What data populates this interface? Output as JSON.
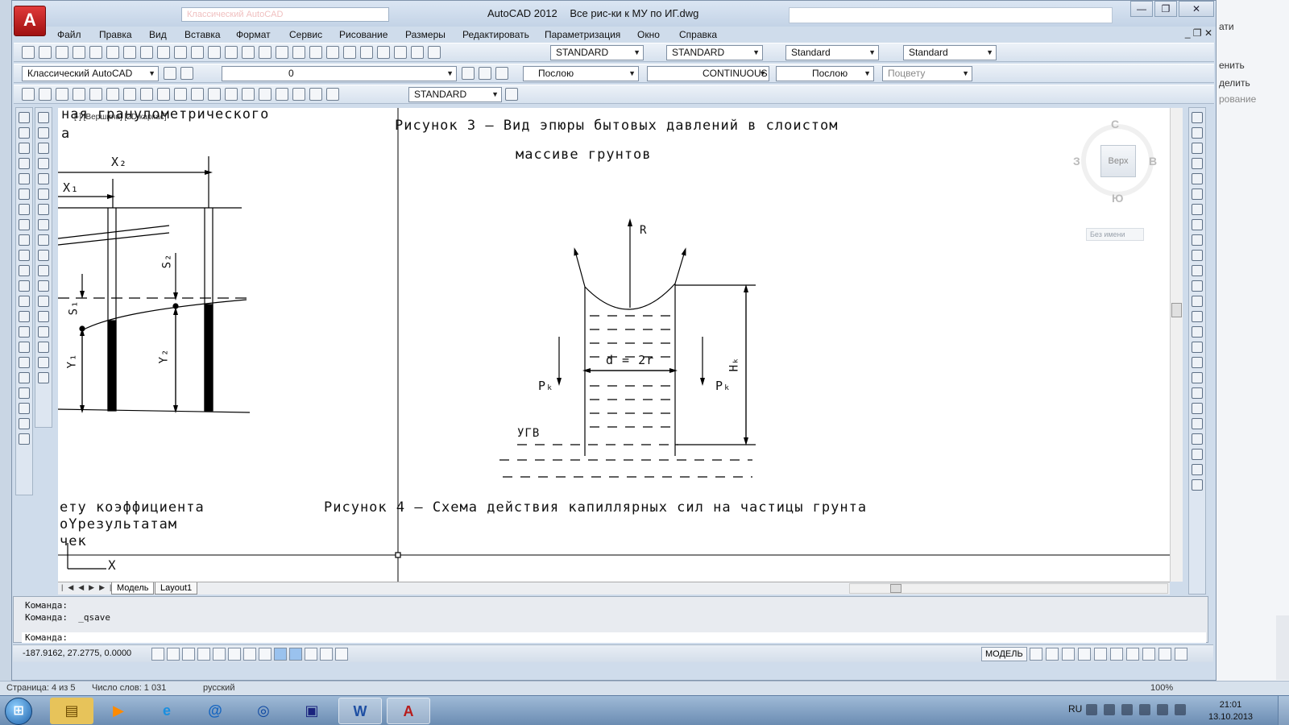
{
  "window": {
    "quick_access_value": "Классический AutoCAD",
    "app_name": "AutoCAD 2012",
    "file_name": "Все рис-ки к МУ по ИГ.dwg",
    "minimize": "—",
    "restore": "❐",
    "close": "✕"
  },
  "menu": [
    "Файл",
    "Правка",
    "Вид",
    "Вставка",
    "Формат",
    "Сервис",
    "Рисование",
    "Размеры",
    "Редактировать",
    "Параметризация",
    "Окно",
    "Справка"
  ],
  "doc_controls": "_ ❐ ✕",
  "toolbar1": {
    "text_style": "STANDARD",
    "dim_style": "STANDARD",
    "table_style": "Standard",
    "mleader_style": "Standard"
  },
  "toolbar2": {
    "workspace": "Классический AutoCAD",
    "layer": "0",
    "color": "Послою",
    "linetype": "CONTINUOUS",
    "lineweight": "Послою",
    "plotstyle": "Поцвету"
  },
  "toolbar3": {
    "dim_style": "STANDARD"
  },
  "viewport_label": "[-] [Вершина] [2D каркас]",
  "drawing": {
    "left_top_caption": "ная гранулометрического",
    "left_top_caption2": "а",
    "fig3_title_line1": "Рисунок 3 – Вид эпюры бытовых давлений в слоистом",
    "fig3_title_line2": "массиве грунтов",
    "fig4_title": "Рисунок 4 – Схема действия капиллярных сил на частицы грунта",
    "left_bottom_1": "ету коэффициента",
    "left_bottom_2": "оYрезультатам",
    "left_bottom_3": "чек",
    "labels": {
      "X2": "X₂",
      "X1": "X₁",
      "S2": "S₂",
      "S1": "S₁",
      "Y1": "Y₁",
      "Y2": "Y₂",
      "R": "R",
      "d": "d = 2r",
      "Pk_left": "Pₖ",
      "Pk_right": "Pₖ",
      "Hk": "Hₖ",
      "UGV": "УГВ",
      "ucs_x": "X"
    }
  },
  "viewcube": {
    "north": "С",
    "south": "Ю",
    "west": "З",
    "east": "В",
    "face": "Верх",
    "ucs_name": "Без имени"
  },
  "tabs": {
    "model": "Модель",
    "layout": "Layout1"
  },
  "command": {
    "line1": "Команда:",
    "line2": "Команда:  _qsave",
    "prompt": "Команда:"
  },
  "status": {
    "coords": "-187.9162, 27.2775, 0.0000",
    "space": "МОДЕЛЬ"
  },
  "background_word": {
    "item1": "ати",
    "item2": "енить",
    "item3": "делить",
    "item4": "рование",
    "status_page": "Страница: 4 из 5",
    "status_words": "Число слов: 1 031",
    "status_lang": "русский",
    "zoom": "100%"
  },
  "taskbar": {
    "lang": "RU",
    "time": "21:01",
    "date": "13.10.2013"
  }
}
